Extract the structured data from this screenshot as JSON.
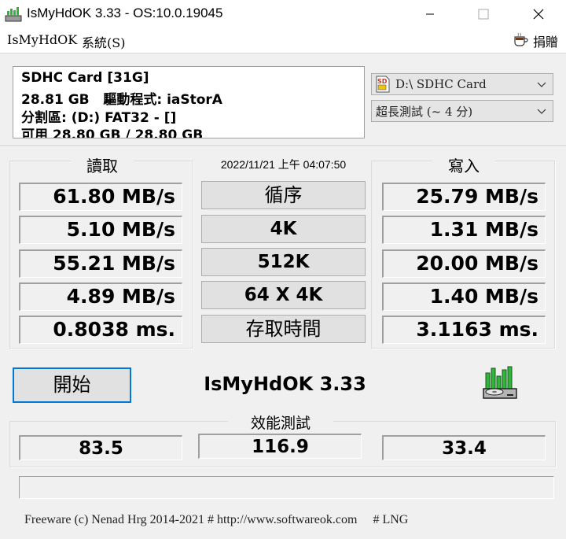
{
  "window": {
    "title": "IsMyHdOK 3.33 - OS:10.0.19045"
  },
  "menu": {
    "items": [
      "IsMyHdOK",
      "系統(S)"
    ],
    "donate_label": "捐贈"
  },
  "drive_info": {
    "line1": "SDHC Card [31G]",
    "line2": "28.81 GB   驅動程式: iaStorA",
    "line3": "分割區: (D:) FAT32 - []",
    "line4": "可用 28.80 GB / 28.80 GB"
  },
  "drive_select": {
    "value": "D:\\ SDHC Card",
    "icon_label": "SD"
  },
  "test_select": {
    "value": "超長測試 (~ 4 分)"
  },
  "results": {
    "read_title": "讀取",
    "write_title": "寫入",
    "timestamp": "2022/11/21 上午 04:07:50",
    "read_values": [
      "61.80 MB/s",
      "5.10 MB/s",
      "55.21 MB/s",
      "4.89 MB/s",
      "0.8038 ms."
    ],
    "write_values": [
      "25.79 MB/s",
      "1.31 MB/s",
      "20.00 MB/s",
      "1.40 MB/s",
      "3.1163 ms."
    ],
    "test_labels": [
      "循序",
      "4K",
      "512K",
      "64 X 4K",
      "存取時間"
    ]
  },
  "start_label": "開始",
  "app_name": "IsMyHdOK 3.33",
  "performance": {
    "title": "效能測試",
    "scores": [
      "83.5",
      "116.9",
      "33.4"
    ]
  },
  "footer": {
    "text": "Freeware (c) Nenad Hrg 2014-2021 # http://www.softwareok.com     # LNG"
  },
  "colors": {
    "accent": "#0078d7",
    "icon_green": "#2fb53a"
  }
}
